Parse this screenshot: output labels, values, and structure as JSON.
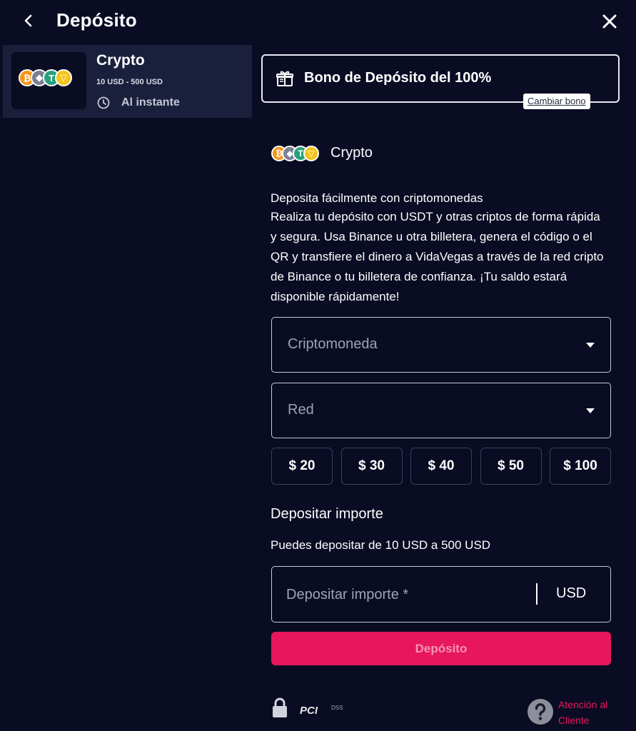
{
  "header": {
    "title": "Depósito",
    "back_icon": "chevron-left-icon",
    "close_icon": "close-icon"
  },
  "method": {
    "name": "Crypto",
    "range": "10 USD - 500 USD",
    "speed": "Al instante",
    "icons": [
      "btc-icon",
      "eth-icon",
      "usdt-icon",
      "trx-icon"
    ]
  },
  "bonus": {
    "label": "Bono de Depósito del 100%",
    "change_label": "Cambiar bono",
    "icon": "gift-icon"
  },
  "crypto_section": {
    "title": "Crypto",
    "description_title": "Deposita fácilmente con criptomonedas",
    "description_body": "Realiza tu depósito con USDT y otras criptos de forma rápida y segura. Usa Binance u otra billetera, genera el código o el QR y transfiere el dinero a VidaVegas a través de la red cripto de Binance o tu billetera de confianza. ¡Tu saldo estará disponible rápidamente!"
  },
  "selects": {
    "currency_placeholder": "Criptomoneda",
    "network_placeholder": "Red"
  },
  "amount_chips": [
    "$ 20",
    "$ 30",
    "$ 40",
    "$ 50",
    "$ 100"
  ],
  "amount": {
    "title": "Depositar importe",
    "hint": "Puedes depositar de 10 USD a 500 USD",
    "placeholder": "Depositar importe *",
    "currency": "USD"
  },
  "deposit_button": "Depósito",
  "footer": {
    "pci_label": "PCI",
    "pci_sub": "DSS",
    "support_label": "Atención al Cliente"
  },
  "colors": {
    "background": "#090c23",
    "card": "#1a1f3b",
    "accent": "#e8175d"
  }
}
